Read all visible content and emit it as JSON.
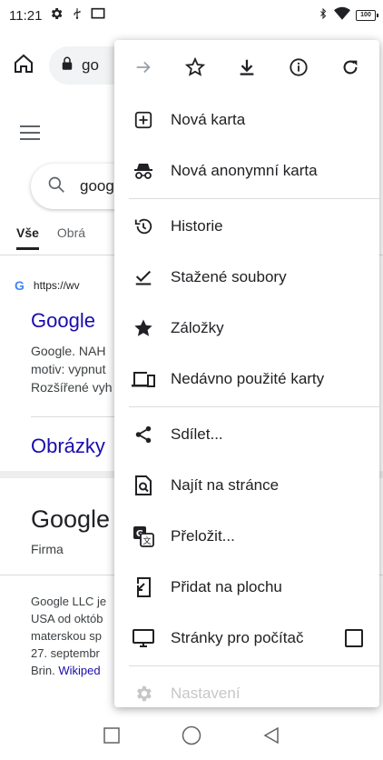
{
  "status": {
    "time": "11:21",
    "battery": "100"
  },
  "toolbar": {
    "url_text": "go"
  },
  "page": {
    "search_query": "goog",
    "tabs": [
      "Vše",
      "Obrá"
    ],
    "result": {
      "url": "https://wv",
      "title": "Google",
      "snippet": [
        "Google. NAH",
        "motiv: vypnut",
        "Rozšířené vyh"
      ]
    },
    "sub_link": "Obrázky",
    "knowledge": {
      "title": "Google",
      "type": "Firma",
      "desc": [
        "Google LLC je",
        "USA od októb",
        "materskou sp",
        "27. septembr"
      ],
      "last_line": "Brin.",
      "wiki_link": "Wikiped"
    }
  },
  "menu": {
    "icons": [
      "forward-icon",
      "star-outline-icon",
      "download-icon",
      "info-icon",
      "refresh-icon"
    ],
    "items": [
      {
        "label": "Nová karta",
        "icon": "new-tab-icon"
      },
      {
        "label": "Nová anonymní karta",
        "icon": "incognito-icon"
      },
      {
        "label": "Historie",
        "icon": "history-icon"
      },
      {
        "label": "Stažené soubory",
        "icon": "downloads-icon"
      },
      {
        "label": "Záložky",
        "icon": "bookmarks-icon"
      },
      {
        "label": "Nedávno použité karty",
        "icon": "recent-tabs-icon"
      },
      {
        "label": "Sdílet...",
        "icon": "share-icon"
      },
      {
        "label": "Najít na stránce",
        "icon": "find-in-page-icon"
      },
      {
        "label": "Přeložit...",
        "icon": "translate-icon"
      },
      {
        "label": "Přidat na plochu",
        "icon": "add-to-home-icon"
      },
      {
        "label": "Stránky pro počítač",
        "icon": "desktop-icon"
      },
      {
        "label": "Nastavení",
        "icon": "settings-icon"
      }
    ]
  }
}
